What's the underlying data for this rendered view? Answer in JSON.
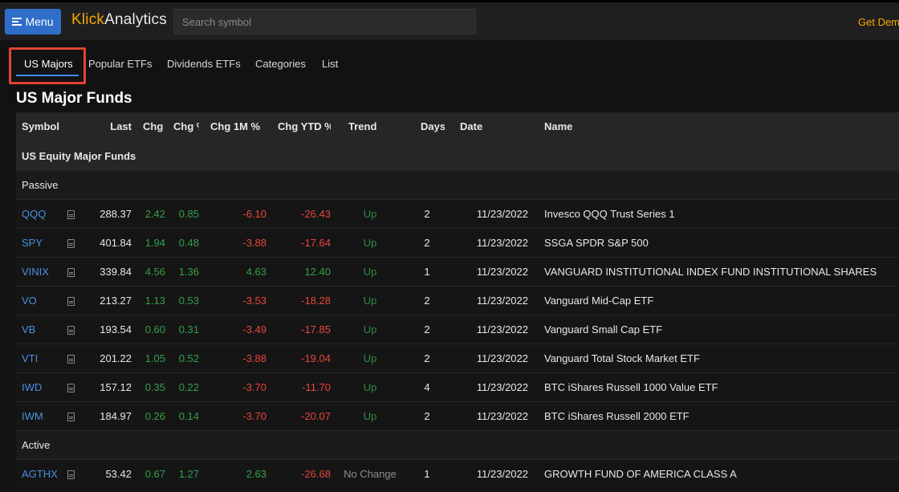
{
  "header": {
    "menu_label": "Menu",
    "brand_part1": "Klick",
    "brand_part2": "Analytics",
    "search_placeholder": "Search symbol",
    "get_demo": "Get Dem"
  },
  "tabs": [
    {
      "label": "US Majors",
      "active": true
    },
    {
      "label": "Popular ETFs",
      "active": false
    },
    {
      "label": "Dividends ETFs",
      "active": false
    },
    {
      "label": "Categories",
      "active": false
    },
    {
      "label": "List",
      "active": false
    }
  ],
  "page_title": "US Major Funds",
  "table": {
    "columns": [
      "Symbol",
      "Last",
      "Chg",
      "Chg %",
      "Chg 1M %",
      "Chg YTD %",
      "Trend",
      "Days",
      "Date",
      "Name"
    ],
    "group_label": "US Equity Major Funds",
    "sections": [
      {
        "label": "Passive",
        "rows": [
          {
            "symbol": "QQQ",
            "last": "288.37",
            "chg": "2.42",
            "chg_pct": "0.85",
            "chg_1m": "-6.10",
            "chg_ytd": "-26.43",
            "trend": "Up",
            "days": "2",
            "date": "11/23/2022",
            "name": "Invesco QQQ Trust Series 1"
          },
          {
            "symbol": "SPY",
            "last": "401.84",
            "chg": "1.94",
            "chg_pct": "0.48",
            "chg_1m": "-3.88",
            "chg_ytd": "-17.64",
            "trend": "Up",
            "days": "2",
            "date": "11/23/2022",
            "name": "SSGA SPDR S&P 500"
          },
          {
            "symbol": "VINIX",
            "last": "339.84",
            "chg": "4.56",
            "chg_pct": "1.36",
            "chg_1m": "4.63",
            "chg_ytd": "12.40",
            "trend": "Up",
            "days": "1",
            "date": "11/23/2022",
            "name": "VANGUARD INSTITUTIONAL INDEX FUND INSTITUTIONAL SHARES"
          },
          {
            "symbol": "VO",
            "last": "213.27",
            "chg": "1.13",
            "chg_pct": "0.53",
            "chg_1m": "-3.53",
            "chg_ytd": "-18.28",
            "trend": "Up",
            "days": "2",
            "date": "11/23/2022",
            "name": "Vanguard Mid-Cap ETF"
          },
          {
            "symbol": "VB",
            "last": "193.54",
            "chg": "0.60",
            "chg_pct": "0.31",
            "chg_1m": "-3.49",
            "chg_ytd": "-17.85",
            "trend": "Up",
            "days": "2",
            "date": "11/23/2022",
            "name": "Vanguard Small Cap ETF"
          },
          {
            "symbol": "VTI",
            "last": "201.22",
            "chg": "1.05",
            "chg_pct": "0.52",
            "chg_1m": "-3.88",
            "chg_ytd": "-19.04",
            "trend": "Up",
            "days": "2",
            "date": "11/23/2022",
            "name": "Vanguard Total Stock Market ETF"
          },
          {
            "symbol": "IWD",
            "last": "157.12",
            "chg": "0.35",
            "chg_pct": "0.22",
            "chg_1m": "-3.70",
            "chg_ytd": "-11.70",
            "trend": "Up",
            "days": "4",
            "date": "11/23/2022",
            "name": "BTC iShares Russell 1000 Value ETF"
          },
          {
            "symbol": "IWM",
            "last": "184.97",
            "chg": "0.26",
            "chg_pct": "0.14",
            "chg_1m": "-3.70",
            "chg_ytd": "-20.07",
            "trend": "Up",
            "days": "2",
            "date": "11/23/2022",
            "name": "BTC iShares Russell 2000 ETF"
          }
        ]
      },
      {
        "label": "Active",
        "rows": [
          {
            "symbol": "AGTHX",
            "last": "53.42",
            "chg": "0.67",
            "chg_pct": "1.27",
            "chg_1m": "2.63",
            "chg_ytd": "-26.68",
            "trend": "No Change",
            "days": "1",
            "date": "11/23/2022",
            "name": "GROWTH FUND OF AMERICA CLASS A"
          }
        ]
      }
    ]
  },
  "colors": {
    "accent": "#2f6ec8",
    "brand_orange": "#f5a800",
    "positive": "#33a04a",
    "negative": "#e8453c",
    "link": "#4a8fe0",
    "highlight": "#e0432f"
  }
}
